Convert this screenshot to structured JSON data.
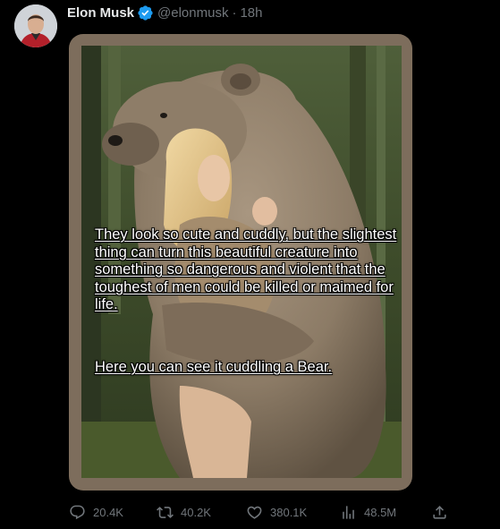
{
  "author": {
    "name": "Elon Musk",
    "handle": "@elonmusk",
    "separator": "·",
    "time": "18h",
    "verified": true
  },
  "media": {
    "caption_main": "They look so cute and cuddly, but the slightest thing can turn this beautiful creature into something so dangerous and violent that the toughest of men could be killed or maimed for life.",
    "caption_punchline": "Here you can see it cuddling a Bear."
  },
  "actions": {
    "replies": "20.4K",
    "reposts": "40.2K",
    "likes": "380.1K",
    "views": "48.5M"
  },
  "icons": {
    "verified": "verified-badge-icon",
    "reply": "speech-bubble-icon",
    "repost": "repost-arrows-icon",
    "like": "heart-icon",
    "views": "bar-chart-icon",
    "share": "share-upload-icon"
  },
  "colors": {
    "background": "#000000",
    "name_text": "#e7e9ea",
    "secondary_text": "#71767b",
    "verified_blue": "#1d9bf0",
    "media_border": "#7d6d5c"
  }
}
